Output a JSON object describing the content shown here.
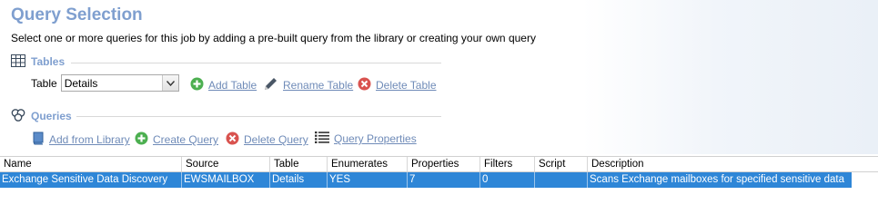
{
  "title": "Query Selection",
  "subtitle": "Select one or more queries for this job by adding a pre-built query from the library or creating your own query",
  "tables_section": {
    "heading": "Tables",
    "table_label": "Table",
    "selected_table": "Details",
    "actions": {
      "add": "Add Table",
      "rename": "Rename Table",
      "delete": "Delete Table"
    }
  },
  "queries_section": {
    "heading": "Queries",
    "actions": {
      "add_library": "Add from Library",
      "create": "Create Query",
      "delete": "Delete Query",
      "properties": "Query Properties"
    }
  },
  "grid": {
    "columns": [
      "Name",
      "Source",
      "Table",
      "Enumerates",
      "Properties",
      "Filters",
      "Script",
      "Description"
    ],
    "rows": [
      [
        "Exchange Sensitive Data Discovery",
        "EWSMAILBOX",
        "Details",
        "YES",
        "7",
        "0",
        "",
        "Scans Exchange mailboxes for specified sensitive data"
      ]
    ]
  },
  "colors": {
    "title_blue": "#7f9fcf",
    "link_blue": "#6f8bb8",
    "selection_blue": "#2e86d7",
    "add_green": "#4caf50",
    "delete_red": "#d9534f"
  },
  "icons": [
    "table-grid-icon",
    "queries-icon",
    "plus-circle-icon",
    "pencil-icon",
    "delete-circle-icon",
    "book-icon",
    "list-icon",
    "chevron-down-icon"
  ]
}
